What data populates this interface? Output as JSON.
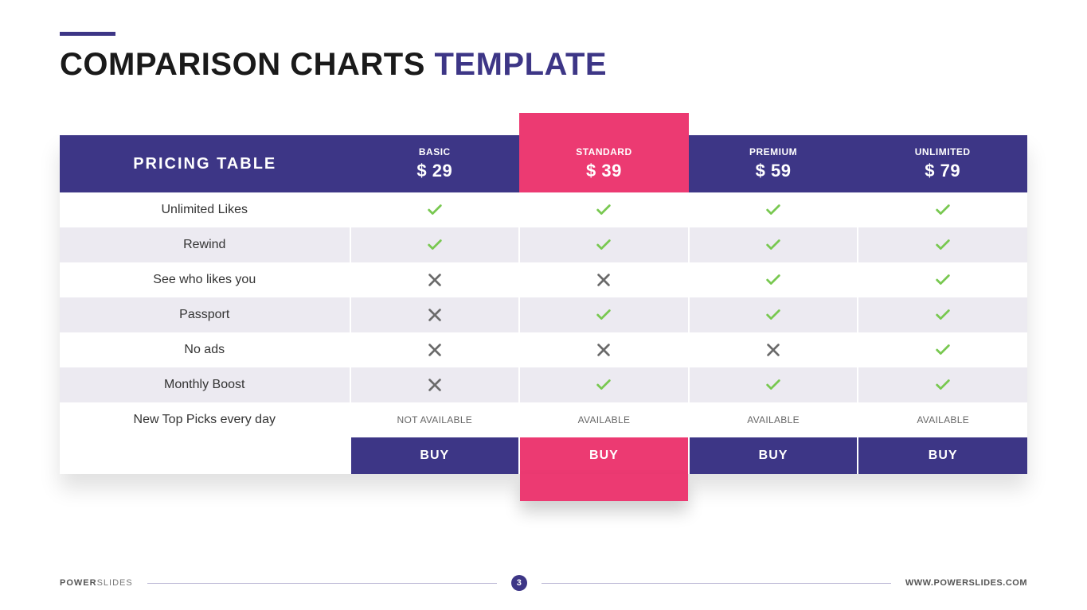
{
  "title": {
    "part1": "COMPARISON CHARTS ",
    "part2": "TEMPLATE"
  },
  "table": {
    "heading": "PRICING TABLE",
    "plans": [
      {
        "name": "BASIC",
        "price": "$ 29",
        "highlight": false,
        "buy": "BUY"
      },
      {
        "name": "STANDARD",
        "price": "$ 39",
        "highlight": true,
        "buy": "BUY"
      },
      {
        "name": "PREMIUM",
        "price": "$ 59",
        "highlight": false,
        "buy": "BUY"
      },
      {
        "name": "UNLIMITED",
        "price": "$ 79",
        "highlight": false,
        "buy": "BUY"
      }
    ],
    "features": [
      {
        "label": "Unlimited Likes",
        "cells": [
          "check",
          "check",
          "check",
          "check"
        ]
      },
      {
        "label": "Rewind",
        "cells": [
          "check",
          "check",
          "check",
          "check"
        ]
      },
      {
        "label": "See who likes you",
        "cells": [
          "cross",
          "cross",
          "check",
          "check"
        ]
      },
      {
        "label": "Passport",
        "cells": [
          "cross",
          "check",
          "check",
          "check"
        ]
      },
      {
        "label": "No ads",
        "cells": [
          "cross",
          "cross",
          "cross",
          "check"
        ]
      },
      {
        "label": "Monthly Boost",
        "cells": [
          "cross",
          "check",
          "check",
          "check"
        ]
      },
      {
        "label": "New Top Picks every day",
        "cells": [
          "NOT AVAILABLE",
          "AVAILABLE",
          "AVAILABLE",
          "AVAILABLE"
        ]
      }
    ]
  },
  "footer": {
    "brand_bold": "POWER",
    "brand_light": "SLIDES",
    "page": "3",
    "url": "WWW.POWERSLIDES.COM"
  },
  "chart_data": {
    "type": "table",
    "title": "PRICING TABLE",
    "columns": [
      "Feature",
      "BASIC $29",
      "STANDARD $39",
      "PREMIUM $59",
      "UNLIMITED $79"
    ],
    "rows": [
      [
        "Unlimited Likes",
        true,
        true,
        true,
        true
      ],
      [
        "Rewind",
        true,
        true,
        true,
        true
      ],
      [
        "See who likes you",
        false,
        false,
        true,
        true
      ],
      [
        "Passport",
        false,
        true,
        true,
        true
      ],
      [
        "No ads",
        false,
        false,
        false,
        true
      ],
      [
        "Monthly Boost",
        false,
        true,
        true,
        true
      ],
      [
        "New Top Picks every day",
        "NOT AVAILABLE",
        "AVAILABLE",
        "AVAILABLE",
        "AVAILABLE"
      ]
    ]
  }
}
